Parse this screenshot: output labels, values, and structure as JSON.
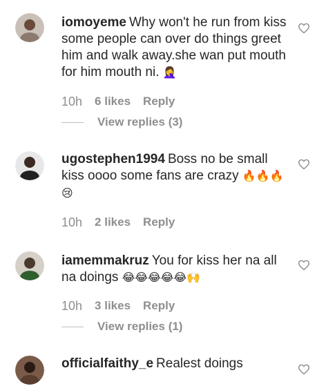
{
  "comments": [
    {
      "username": "iomoyeme",
      "text": "Why won't he run from kiss some people can over do things greet him and walk away.she wan put mouth for him mouth ni.",
      "emoji": "🤦‍♀️",
      "time": "10h",
      "likes": "6 likes",
      "reply": "Reply",
      "view_replies": "View replies (3)"
    },
    {
      "username": "ugostephen1994",
      "text": "Boss no be small kiss oooo some fans are crazy",
      "emoji": "🔥🔥🔥😢",
      "time": "10h",
      "likes": "2 likes",
      "reply": "Reply"
    },
    {
      "username": "iamemmakruz",
      "text": "You for kiss her na all na doings",
      "emoji": "😂😂😂😂😂🙌",
      "time": "10h",
      "likes": "3 likes",
      "reply": "Reply",
      "view_replies": "View replies (1)"
    },
    {
      "username": "officialfaithy_e",
      "text": "Realest doings"
    }
  ],
  "icons": {
    "like": "heart-outline-icon",
    "avatar": "user-avatar"
  },
  "colors": {
    "text": "#262626",
    "muted": "#8e8e8e"
  }
}
